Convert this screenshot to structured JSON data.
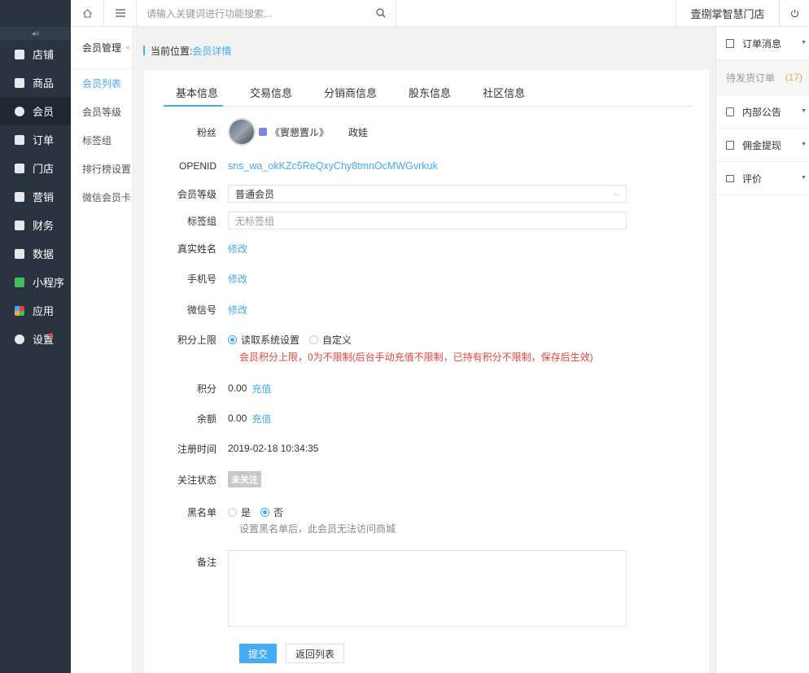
{
  "colors": {
    "accent": "#44abf7",
    "sidebar_bg": "#2a3440",
    "warning_red": "#e8433a",
    "badge_orange": "#f0a64a"
  },
  "sidebar": {
    "items": [
      {
        "label": "店铺",
        "icon": "store-icon"
      },
      {
        "label": "商品",
        "icon": "goods-icon"
      },
      {
        "label": "会员",
        "icon": "member-icon",
        "active": true
      },
      {
        "label": "订单",
        "icon": "order-icon"
      },
      {
        "label": "门店",
        "icon": "shop-icon"
      },
      {
        "label": "营销",
        "icon": "gift-icon"
      },
      {
        "label": "财务",
        "icon": "money-bag-icon"
      },
      {
        "label": "数据",
        "icon": "chart-icon"
      },
      {
        "label": "小程序",
        "icon": "miniprogram-icon"
      },
      {
        "label": "应用",
        "icon": "apps-icon"
      },
      {
        "label": "设置",
        "icon": "gear-icon"
      }
    ]
  },
  "topbar": {
    "search_placeholder": "请输入关键词进行功能搜索...",
    "store_name": "壹捌掌智慧门店"
  },
  "subnav": {
    "title": "会员管理",
    "items": [
      {
        "label": "会员列表",
        "active": true
      },
      {
        "label": "会员等级"
      },
      {
        "label": "标签组"
      },
      {
        "label": "排行榜设置"
      },
      {
        "label": "微信会员卡"
      }
    ]
  },
  "breadcrumb": {
    "prefix": "当前位置:",
    "current": "会员详情"
  },
  "tabs": [
    "基本信息",
    "交易信息",
    "分销商信息",
    "股东信息",
    "社区信息"
  ],
  "form": {
    "fans_label": "粉丝",
    "fans_nickname": "《賨懇置ル》",
    "fans_name": "政娃",
    "openid_label": "OPENID",
    "openid_value": "sns_wa_okKZc5ReQxyChy8tmnOcMWGvrkuk",
    "level_label": "会员等级",
    "level_value": "普通会员",
    "tag_label": "标签组",
    "tag_placeholder": "无标签组",
    "realname_label": "真实姓名",
    "mobile_label": "手机号",
    "wechat_label": "微信号",
    "edit_link": "修改",
    "points_limit_label": "积分上限",
    "points_opt_system": "读取系统设置",
    "points_opt_custom": "自定义",
    "points_warning": "会员积分上限，0为不限制(后台手动充值不限制，已持有积分不限制，保存后生效)",
    "points_label": "积分",
    "points_value": "0.00",
    "balance_label": "余额",
    "balance_value": "0.00",
    "recharge_link": "充值",
    "reg_time_label": "注册时间",
    "reg_time_value": "2019-02-18 10:34:35",
    "follow_label": "关注状态",
    "follow_value": "未关注",
    "blacklist_label": "黑名单",
    "blacklist_yes": "是",
    "blacklist_no": "否",
    "blacklist_help": "设置黑名单后，此会员无法访问商城",
    "remark_label": "备注",
    "submit_label": "提交",
    "back_label": "返回列表"
  },
  "right_panel": {
    "order_msg": "订单消息",
    "pending_ship": "待发货订单",
    "pending_count": "(17)",
    "notice": "内部公告",
    "commission": "佣金提现",
    "review": "评价"
  }
}
